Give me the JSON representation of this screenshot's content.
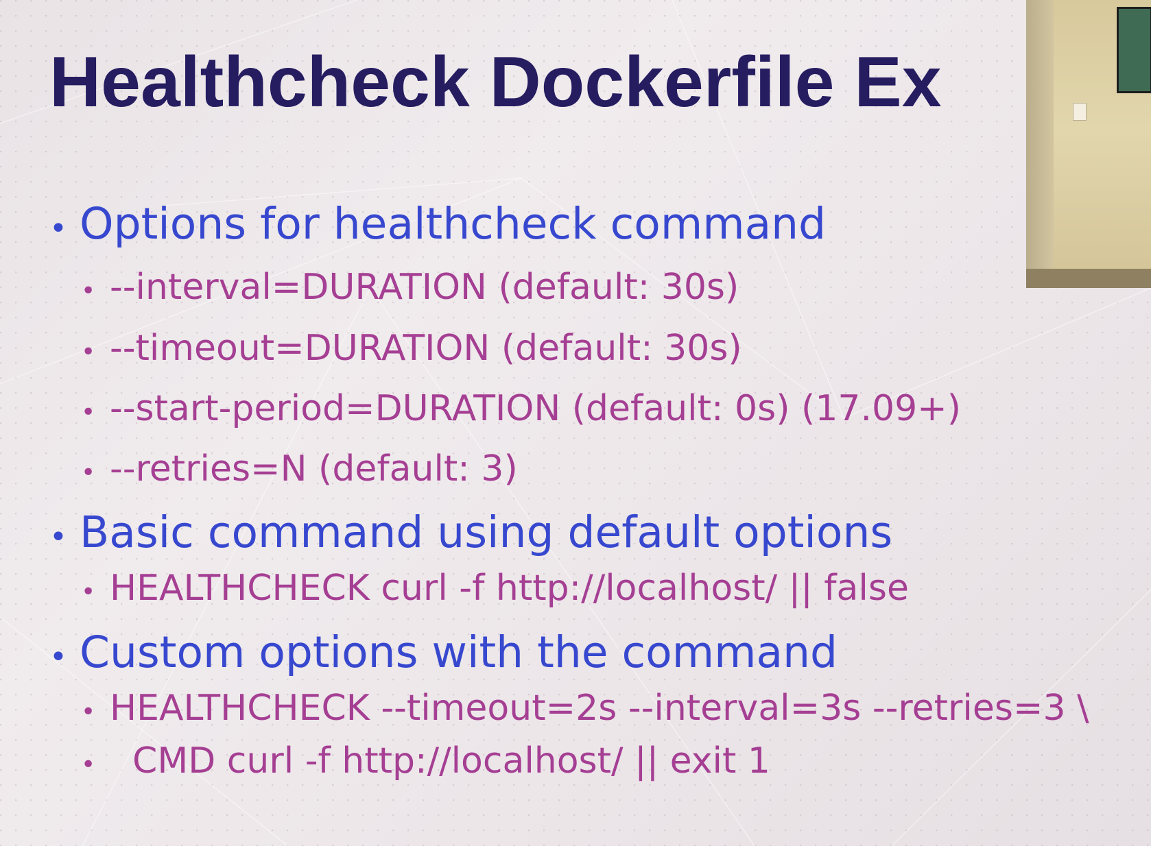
{
  "title": "Healthcheck Dockerfile Ex",
  "bullets": [
    {
      "text": "Options for healthcheck command",
      "sub": [
        "--interval=DURATION (default: 30s)",
        "--timeout=DURATION (default: 30s)",
        "--start-period=DURATION (default: 0s) (17.09+)",
        "--retries=N (default: 3)"
      ]
    },
    {
      "text": "Basic command using default options",
      "sub": [
        "HEALTHCHECK curl -f http://localhost/ || false"
      ]
    },
    {
      "text": "Custom options with the command",
      "sub": [
        "HEALTHCHECK --timeout=2s --interval=3s --retries=3 \\",
        "  CMD curl -f http://localhost/ || exit 1"
      ]
    }
  ],
  "colors": {
    "title": "#261c60",
    "level1": "#3748cf",
    "level2": "#a53f93",
    "background": "#ece6e9"
  },
  "icons": {
    "bullet": "bullet-dot-icon"
  }
}
